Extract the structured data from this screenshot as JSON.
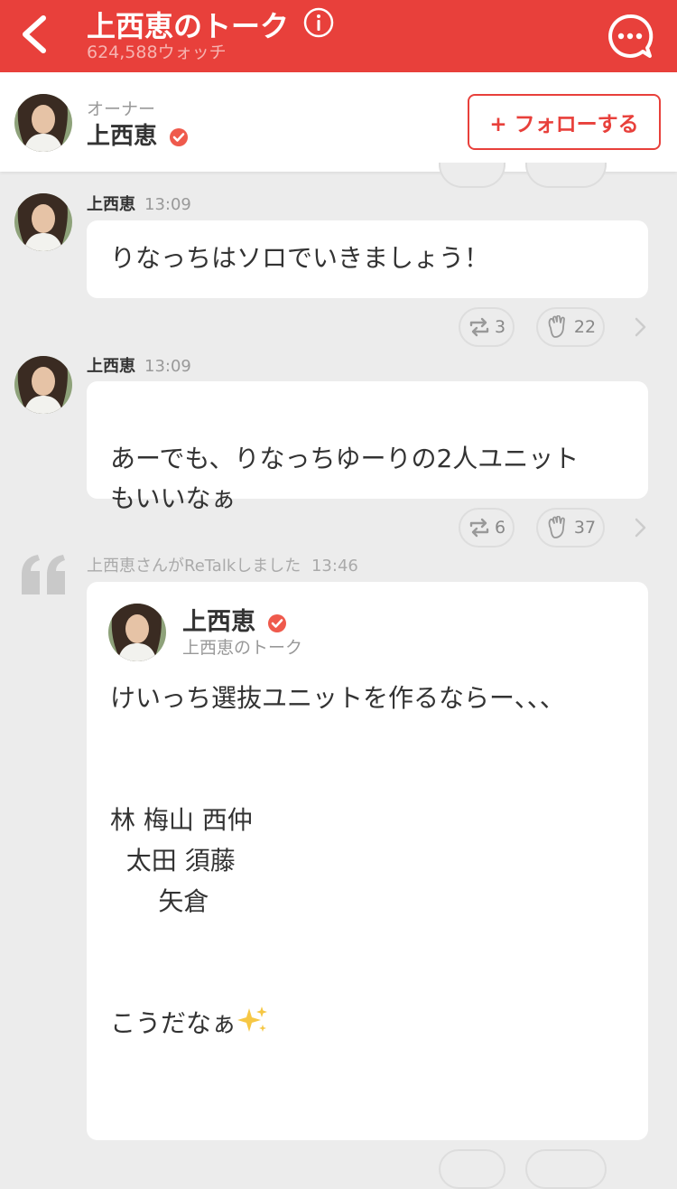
{
  "header": {
    "title": "上西恵のトーク",
    "watch_count": "624,588ウォッチ",
    "accent": "#e8403b"
  },
  "owner": {
    "label": "オーナー",
    "name": "上西恵",
    "follow_label": "+ フォローする"
  },
  "messages": [
    {
      "name": "上西恵",
      "time": "13:09",
      "text": "りなっちはソロでいきましょう！",
      "retalk_count": "3",
      "clap_count": "22"
    },
    {
      "name": "上西恵",
      "time": "13:09",
      "text": "あーでも、りなっちゆーりの2人ユニット\nもいいなぁ",
      "retalk_count": "6",
      "clap_count": "37"
    }
  ],
  "retalk": {
    "meta": "上西恵さんがReTalkしました",
    "time": "13:46",
    "name": "上西恵",
    "source": "上西恵のトーク",
    "body": "けいっち選抜ユニットを作るならー、、、\n\n\n林 梅山 西仲\n  太田 須藤\n      矢倉\n\n\nこうだなぁ"
  }
}
